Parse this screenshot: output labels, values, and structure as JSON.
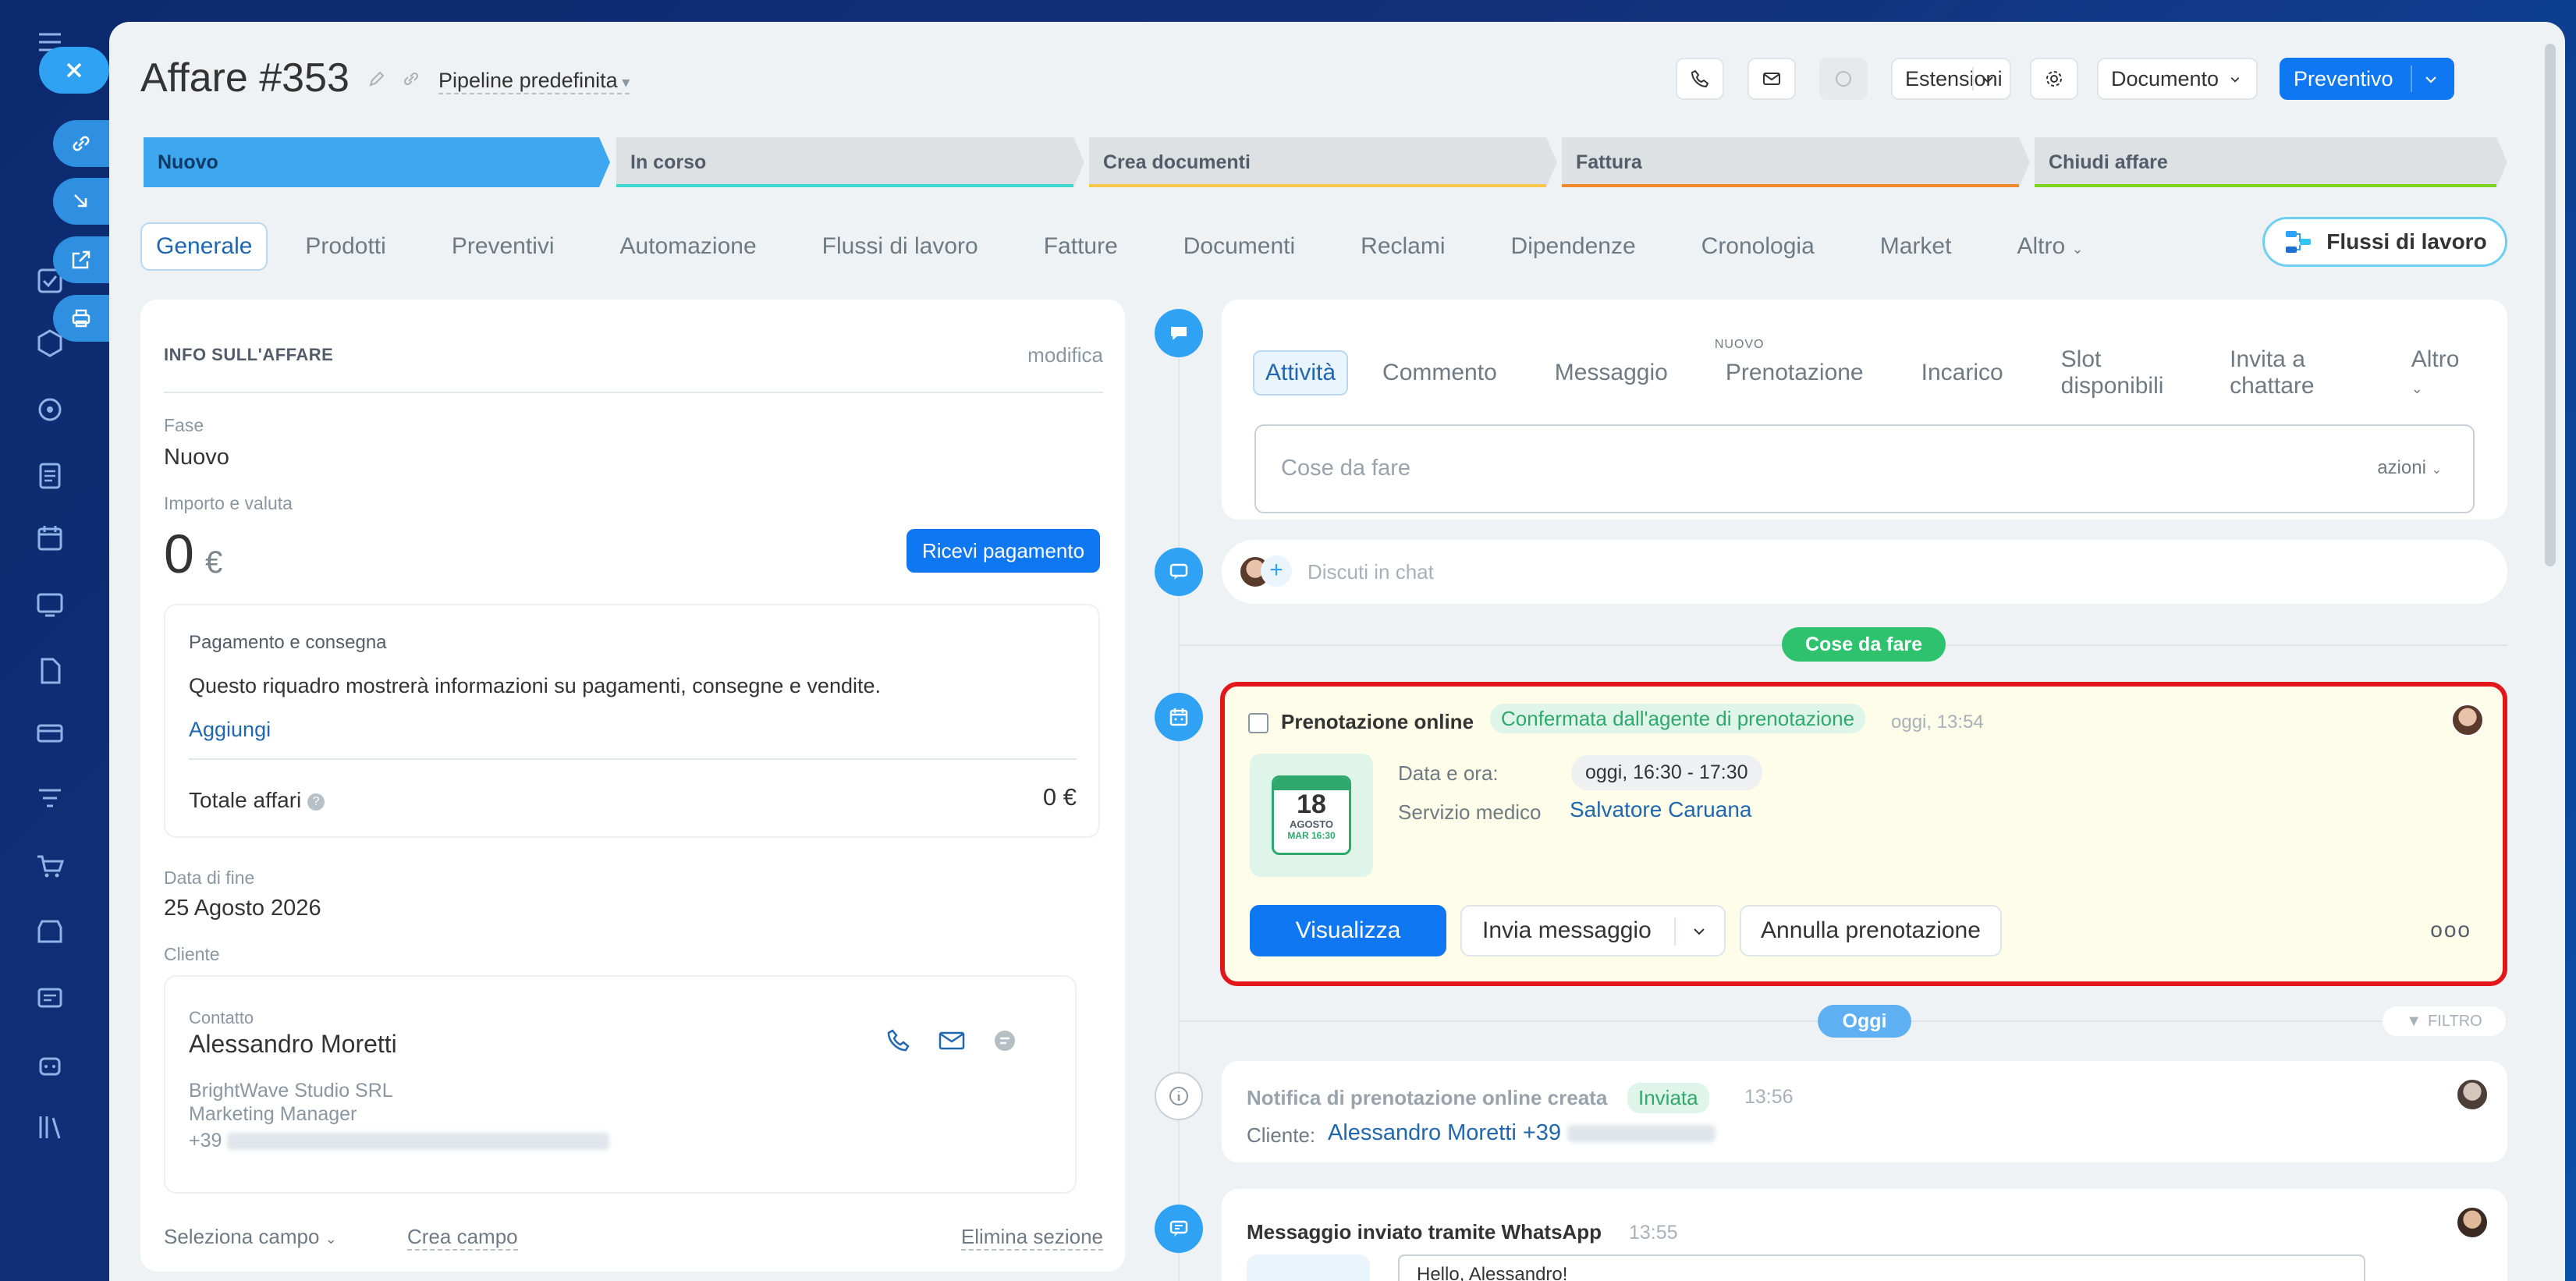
{
  "deal": {
    "title": "Affare #353",
    "pipeline": "Pipeline predefinita"
  },
  "header": {
    "extensions": "Estensioni",
    "document": "Documento",
    "quote": "Preventivo"
  },
  "stages": [
    {
      "label": "Nuovo",
      "color": "#3ea7ef"
    },
    {
      "label": "In corso",
      "color": "#3fd8d0"
    },
    {
      "label": "Crea documenti",
      "color": "#f7c64a"
    },
    {
      "label": "Fattura",
      "color": "#f2892b"
    },
    {
      "label": "Chiudi affare",
      "color": "#7ed321"
    }
  ],
  "tabs": [
    "Generale",
    "Prodotti",
    "Preventivi",
    "Automazione",
    "Flussi di lavoro",
    "Fatture",
    "Documenti",
    "Reclami",
    "Dipendenze",
    "Cronologia",
    "Market",
    "Altro"
  ],
  "workflows_button": "Flussi di lavoro",
  "info": {
    "heading": "INFO SULL'AFFARE",
    "edit": "modifica",
    "stage_label": "Fase",
    "stage_value": "Nuovo",
    "amount_label": "Importo e valuta",
    "amount": "0",
    "currency": "€",
    "receive_payment": "Ricevi pagamento",
    "payment_title": "Pagamento e consegna",
    "payment_text": "Questo riquadro mostrerà informazioni su pagamenti, consegne e vendite.",
    "add": "Aggiungi",
    "total_label": "Totale affari",
    "total_value": "0 €",
    "end_date_label": "Data di fine",
    "end_date": "25 Agosto 2026",
    "client_label": "Cliente",
    "contact_label": "Contatto",
    "contact_name": "Alessandro Moretti",
    "company": "BrightWave Studio SRL",
    "role": "Marketing Manager",
    "phone_prefix": "+39",
    "select_field": "Seleziona campo",
    "create_field": "Crea campo",
    "delete_section": "Elimina sezione"
  },
  "activity": {
    "tabs": [
      "Attività",
      "Commento",
      "Messaggio",
      "Prenotazione",
      "Incarico",
      "Slot disponibili",
      "Invita a chattare",
      "Altro"
    ],
    "new_tag": "NUOVO",
    "todo_placeholder": "Cose da fare",
    "actions": "azioni",
    "chat_placeholder": "Discuti in chat"
  },
  "timeline": {
    "todo_pill": "Cose da fare",
    "today_pill": "Oggi",
    "filter": "FILTRO",
    "booking": {
      "title": "Prenotazione online",
      "status": "Confermata dall'agente di prenotazione",
      "time": "oggi, 13:54",
      "cal_day": "18",
      "cal_month": "AGOSTO",
      "cal_sub": "MAR 16:30",
      "date_label": "Data e ora:",
      "date_value": "oggi, 16:30 - 17:30",
      "service_label": "Servizio medico",
      "service_value": "Salvatore Caruana",
      "view": "Visualizza",
      "send": "Invia messaggio",
      "cancel": "Annulla prenotazione"
    },
    "notification": {
      "title": "Notifica di prenotazione online creata",
      "badge": "Inviata",
      "time": "13:56",
      "client_label": "Cliente:",
      "client": "Alessandro Moretti +39"
    },
    "whatsapp": {
      "title": "Messaggio inviato tramite WhatsApp",
      "time": "13:55",
      "preview": "Hello, Alessandro!"
    }
  }
}
